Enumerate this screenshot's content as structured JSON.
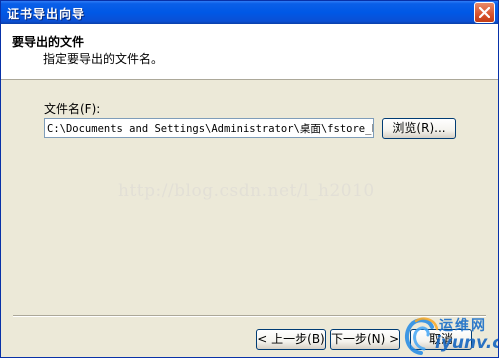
{
  "window": {
    "title": "证书导出向导"
  },
  "header": {
    "title": "要导出的文件",
    "subtitle": "指定要导出的文件名。"
  },
  "form": {
    "file_label": "文件名(F):",
    "file_value": "C:\\Documents and Settings\\Administrator\\桌面\\fstore_ks",
    "browse_label": "浏览(R)..."
  },
  "watermark": {
    "text": "http://blog.csdn.net/l_h2010"
  },
  "footer": {
    "back_label": "< 上一步(B)",
    "next_label": "下一步(N) >",
    "cancel_label": "取消"
  },
  "logo": {
    "cn_text": "运维网",
    "en_text": "iyunv.com"
  },
  "colors": {
    "titlebar": "#0058e6",
    "dialog_bg": "#ece9d8",
    "logo_blue": "#1565c0"
  },
  "icons": {
    "close": "close-icon",
    "logo": "swirl-logo-icon"
  }
}
